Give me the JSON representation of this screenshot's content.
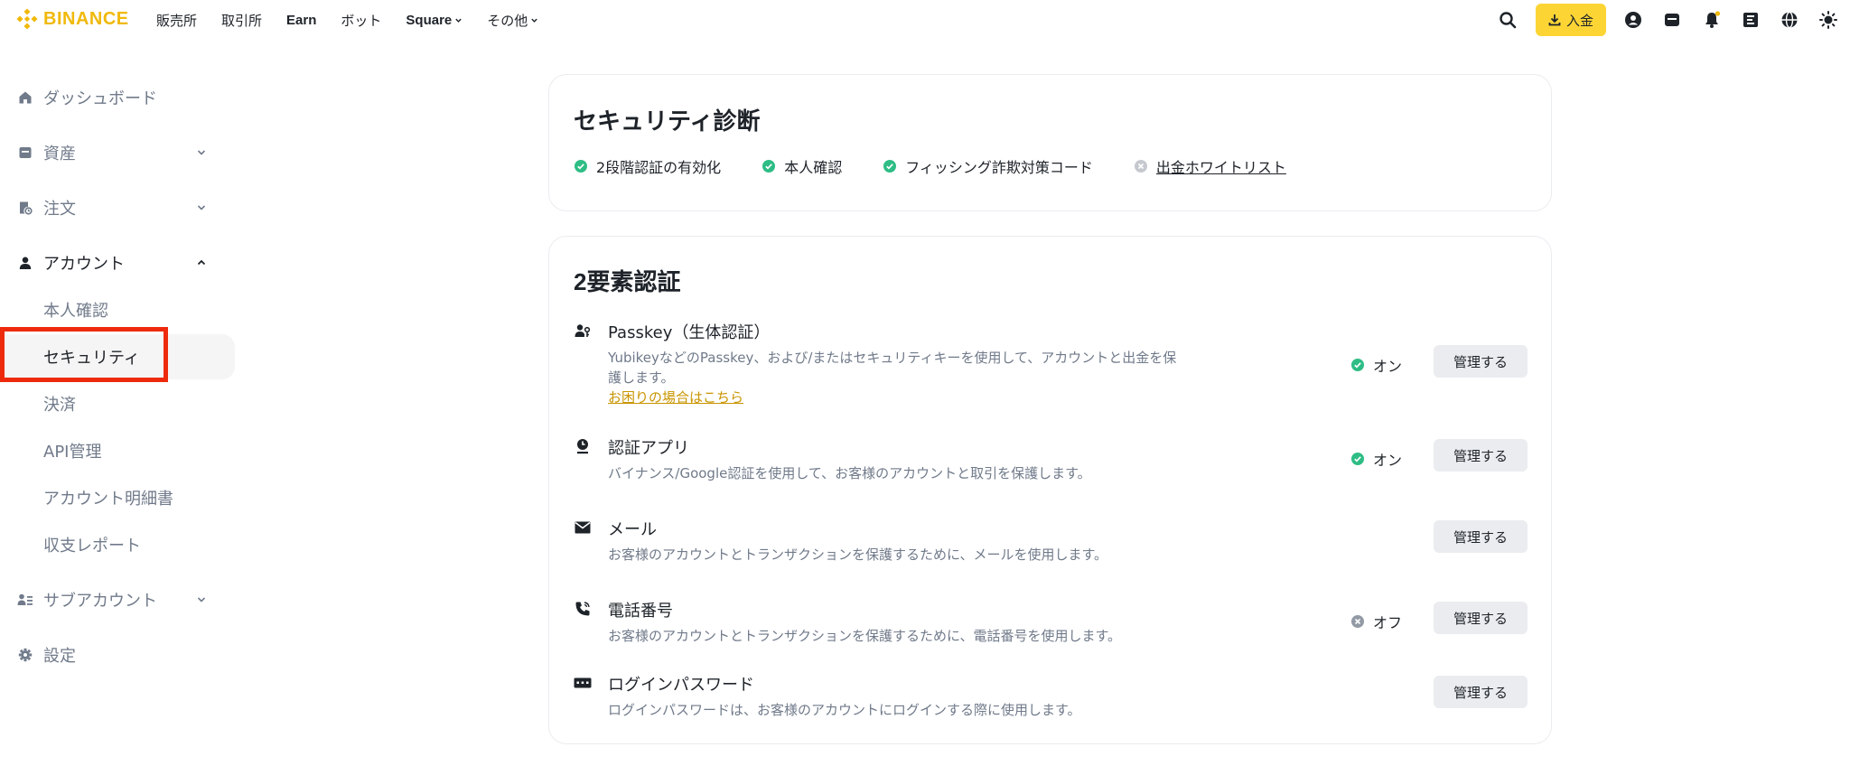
{
  "brand": {
    "name": "BINANCE",
    "color": "#f0b90b"
  },
  "nav": [
    {
      "label": "販売所",
      "bold": false,
      "dropdown": false
    },
    {
      "label": "取引所",
      "bold": false,
      "dropdown": false
    },
    {
      "label": "Earn",
      "bold": true,
      "dropdown": false
    },
    {
      "label": "ボット",
      "bold": false,
      "dropdown": false
    },
    {
      "label": "Square",
      "bold": true,
      "dropdown": true
    },
    {
      "label": "その他",
      "bold": false,
      "dropdown": true
    }
  ],
  "header": {
    "deposit_label": "入金",
    "icons": [
      "search-icon",
      "download-icon",
      "user-icon",
      "wallet-icon",
      "bell-icon",
      "qr-download-icon",
      "globe-icon",
      "theme-icon"
    ]
  },
  "sidebar": {
    "items": [
      {
        "label": "ダッシュボード",
        "icon": "home-icon",
        "caret": ""
      },
      {
        "label": "資産",
        "icon": "wallet-icon",
        "caret": "down"
      },
      {
        "label": "注文",
        "icon": "orders-icon",
        "caret": "down"
      },
      {
        "label": "アカウント",
        "icon": "user-icon",
        "caret": "up"
      },
      {
        "label": "サブアカウント",
        "icon": "subaccount-icon",
        "caret": "down"
      },
      {
        "label": "設定",
        "icon": "gear-icon",
        "caret": ""
      }
    ],
    "account_sub": [
      {
        "label": "本人確認",
        "selected": false
      },
      {
        "label": "セキュリティ",
        "selected": true
      },
      {
        "label": "決済",
        "selected": false
      },
      {
        "label": "API管理",
        "selected": false
      },
      {
        "label": "アカウント明細書",
        "selected": false
      },
      {
        "label": "収支レポート",
        "selected": false
      }
    ]
  },
  "diagnosis": {
    "title": "セキュリティ診断",
    "items": [
      {
        "label": "2段階認証の有効化",
        "status": "done"
      },
      {
        "label": "本人確認",
        "status": "done"
      },
      {
        "label": "フィッシング詐欺対策コード",
        "status": "done"
      },
      {
        "label": "出金ホワイトリスト",
        "status": "not-set"
      }
    ]
  },
  "two_factor": {
    "title": "2要素認証",
    "methods": [
      {
        "name": "Passkey（生体認証）",
        "icon": "passkey-icon",
        "desc": "YubikeyなどのPasskey、および/またはセキュリティキーを使用して、アカウントと出金を保護します。",
        "help": "お困りの場合はこちら",
        "status": "オン",
        "status_type": "on",
        "button": "管理する"
      },
      {
        "name": "認証アプリ",
        "icon": "authenticator-icon",
        "desc": "バイナンス/Google認証を使用して、お客様のアカウントと取引を保護します。",
        "help": "",
        "status": "オン",
        "status_type": "on",
        "button": "管理する"
      },
      {
        "name": "メール",
        "icon": "mail-icon",
        "desc": "お客様のアカウントとトランザクションを保護するために、メールを使用します。",
        "help": "",
        "status": "",
        "status_type": "none",
        "button": "管理する"
      },
      {
        "name": "電話番号",
        "icon": "phone-icon",
        "desc": "お客様のアカウントとトランザクションを保護するために、電話番号を使用します。",
        "help": "",
        "status": "オフ",
        "status_type": "off",
        "button": "管理する"
      },
      {
        "name": "ログインパスワード",
        "icon": "password-icon",
        "desc": "ログインパスワードは、お客様のアカウントにログインする際に使用します。",
        "help": "",
        "status": "",
        "status_type": "none",
        "button": "管理する"
      }
    ]
  },
  "colors": {
    "accent": "#fcd535",
    "success": "#2ebd85",
    "muted": "#707a8a",
    "off": "#929aa5",
    "highlight": "#ee2a0d"
  }
}
